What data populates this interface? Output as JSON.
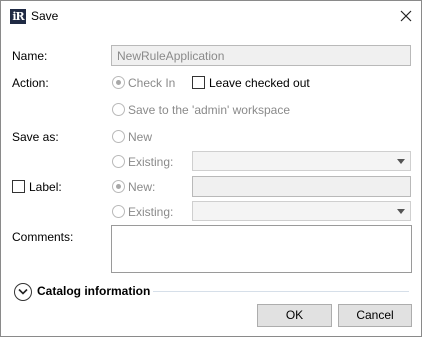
{
  "window": {
    "title": "Save",
    "app_icon_text": "iR"
  },
  "form": {
    "name_label": "Name:",
    "name_value": "NewRuleApplication",
    "action_label": "Action:",
    "action_check_in": "Check In",
    "action_leave_checked_out": "Leave checked out",
    "action_save_workspace": "Save to the 'admin' workspace",
    "save_as_label": "Save as:",
    "save_as_new": "New",
    "save_as_existing": "Existing:",
    "label_label": "Label:",
    "label_new": "New:",
    "label_existing": "Existing:",
    "comments_label": "Comments:"
  },
  "catalog": {
    "section_title": "Catalog information"
  },
  "buttons": {
    "ok": "OK",
    "cancel": "Cancel"
  }
}
